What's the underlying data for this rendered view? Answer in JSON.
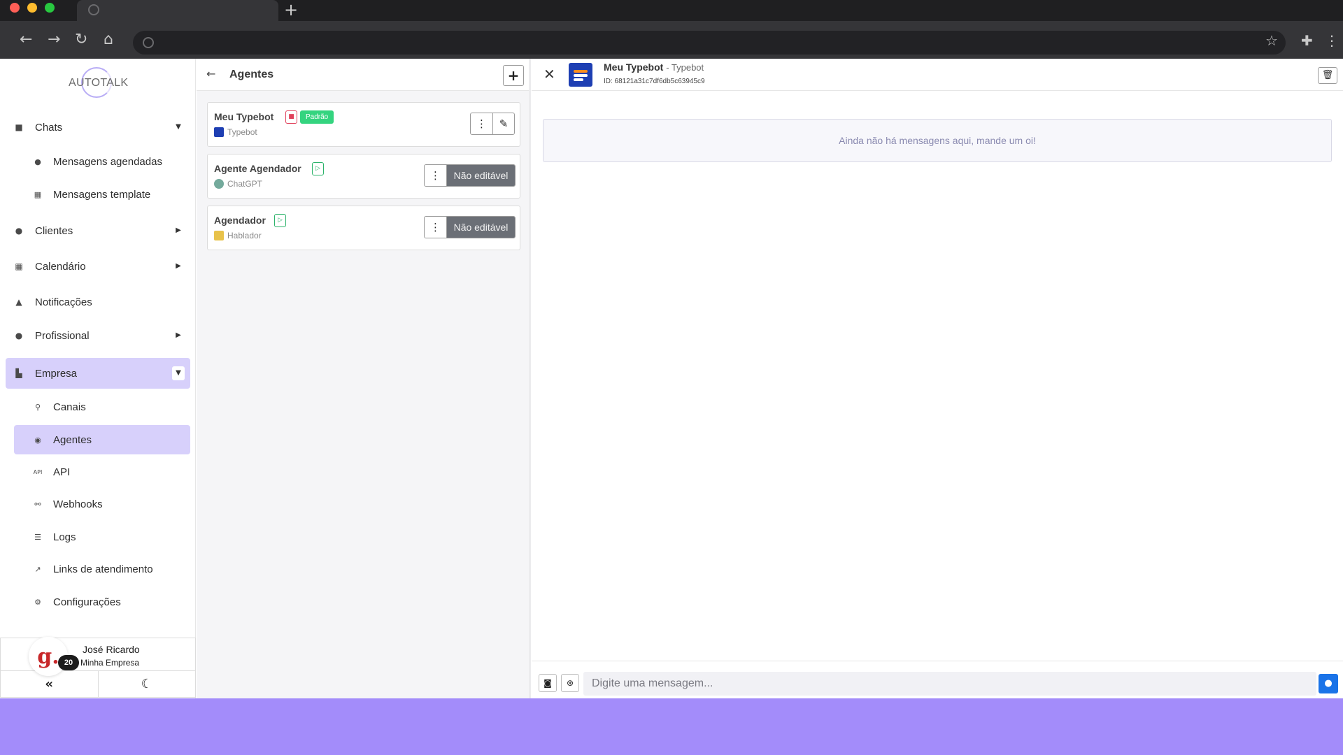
{
  "colors": {
    "accent": "#d7d0fb",
    "page_bg": "#a38cfa",
    "badge_green": "#34d47f",
    "mic_blue": "#1a73e8",
    "typebot_blue": "#1e3fb3"
  },
  "browser": {
    "new_tab_icon": "+"
  },
  "sidebar": {
    "logo": "AUTOTALK",
    "chats": "Chats",
    "chats_sub": [
      "Mensagens agendadas",
      "Mensagens template"
    ],
    "clientes": "Clientes",
    "calendario": "Calendário",
    "notificacoes": "Notificações",
    "profissional": "Profissional",
    "empresa": "Empresa",
    "empresa_sub": [
      "Canais",
      "Agentes",
      "API",
      "Webhooks",
      "Logs",
      "Links de atendimento",
      "Configurações"
    ]
  },
  "user": {
    "avatar_letter": "g.",
    "badge": "20",
    "name": "José Ricardo",
    "company": "Minha Empresa"
  },
  "agents_panel": {
    "title": "Agentes",
    "items": [
      {
        "name": "Meu Typebot",
        "badge": "Padrão",
        "provider": "Typebot"
      },
      {
        "name": "Agente Agendador",
        "provider": "ChatGPT",
        "action": "Não editável"
      },
      {
        "name": "Agendador",
        "provider": "Hablador",
        "action": "Não editável"
      }
    ]
  },
  "chat": {
    "title": "Meu Typebot",
    "title_suffix": "- Typebot",
    "id_line": "ID: 68121a31c7df6db5c63945c9",
    "empty_message": "Ainda não há mensagens aqui, mande um oi!",
    "input_placeholder": "Digite uma mensagem..."
  }
}
